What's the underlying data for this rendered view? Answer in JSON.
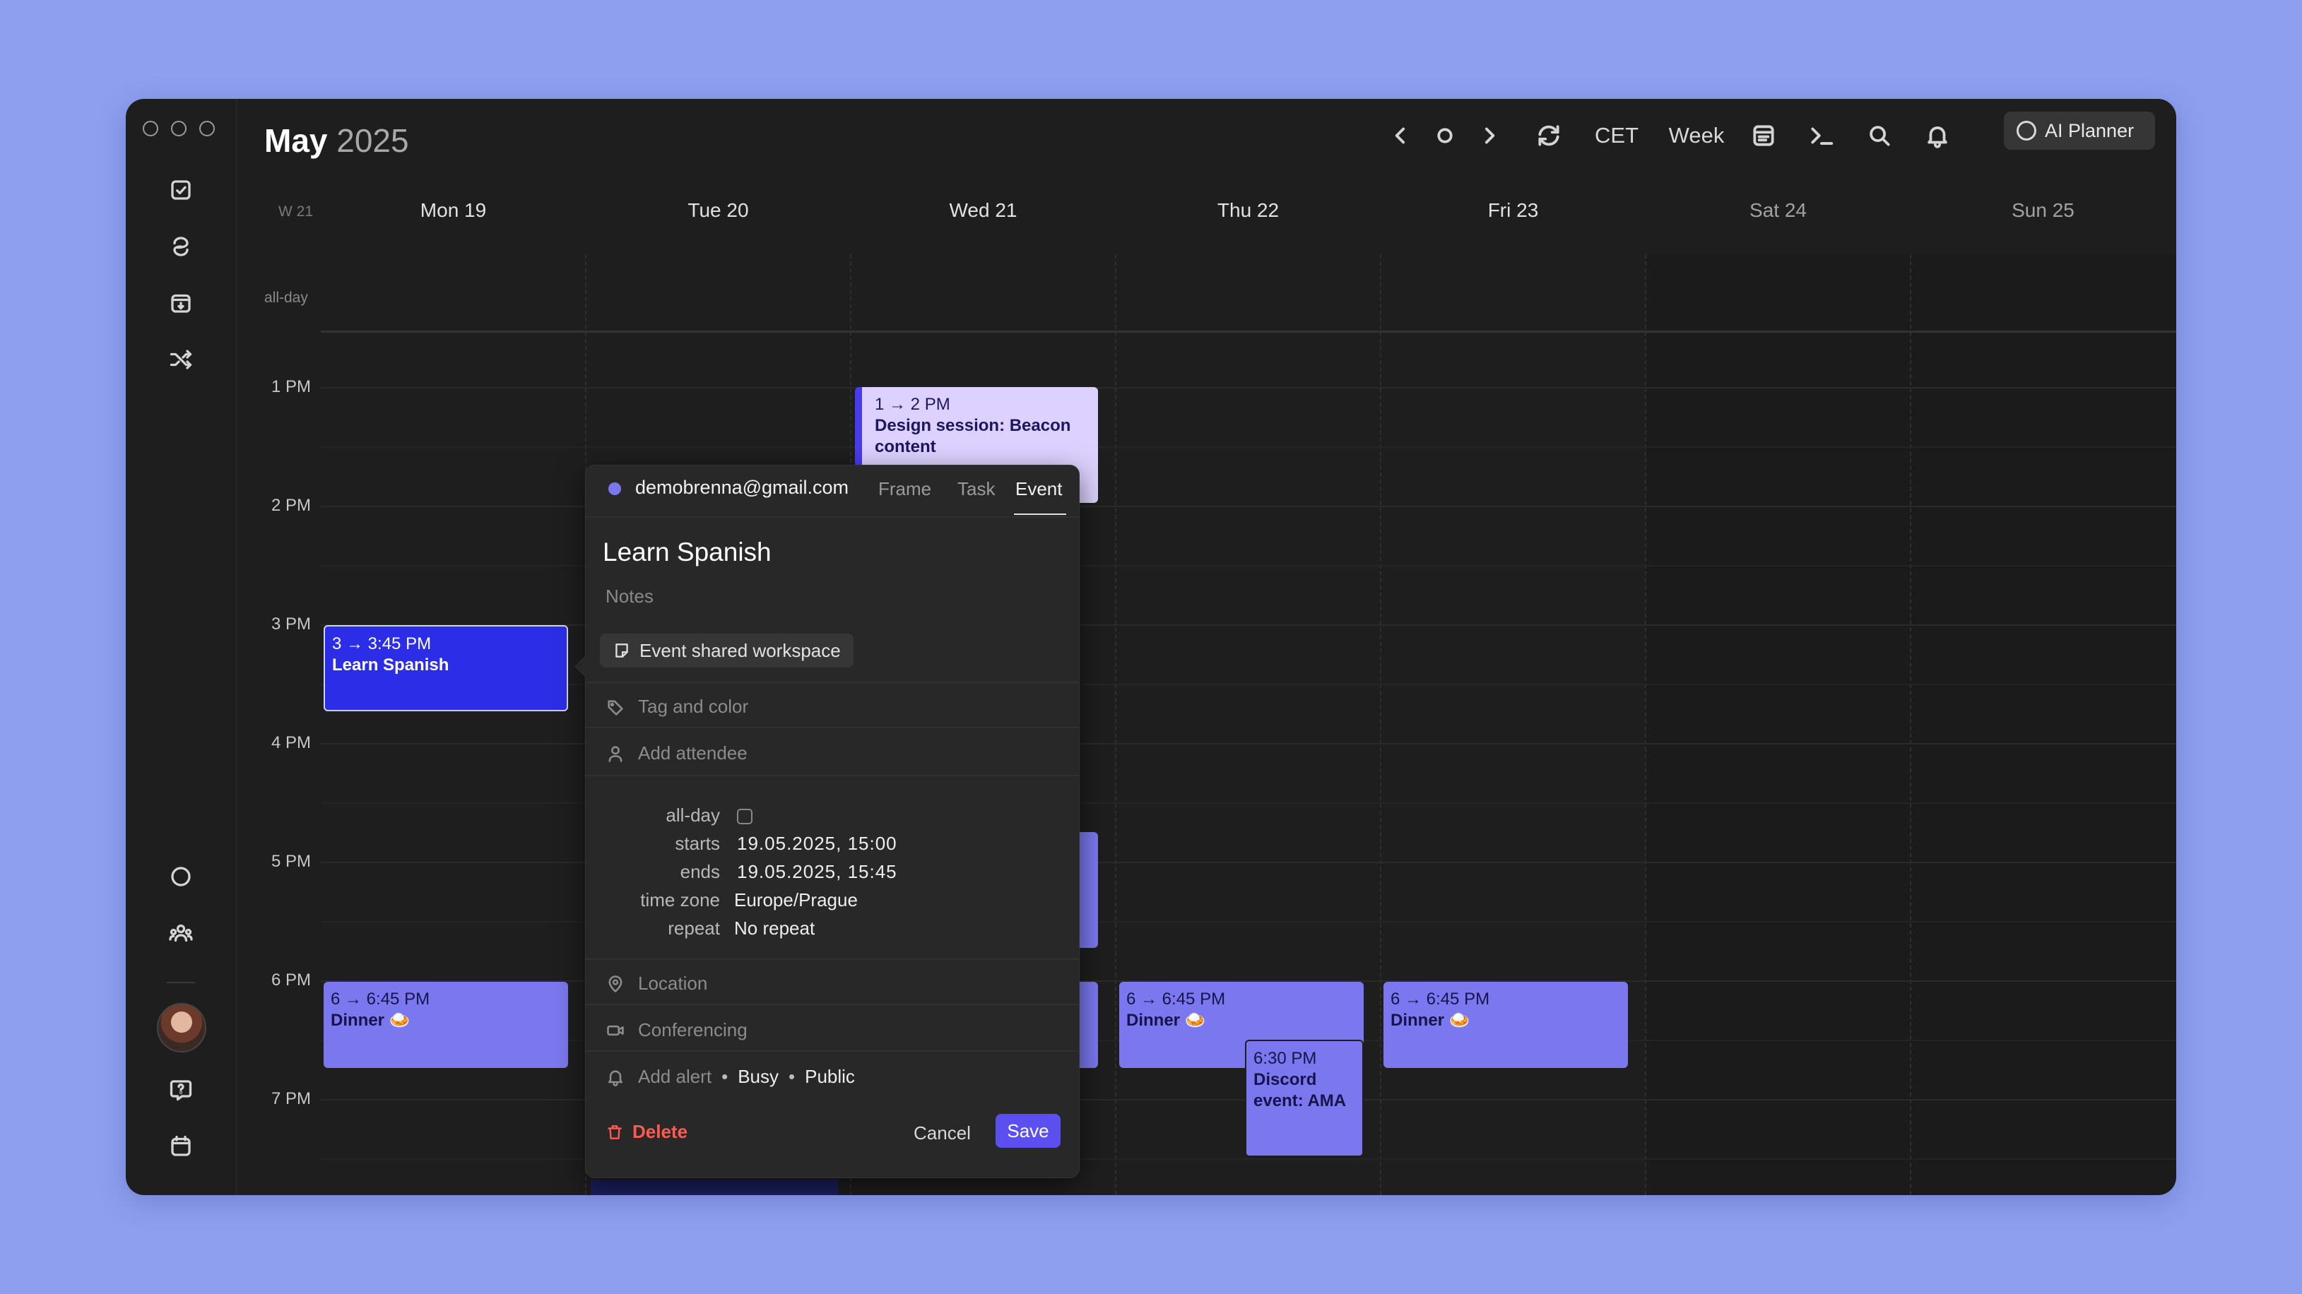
{
  "window": {
    "title_month": "May",
    "title_year": "2025"
  },
  "header": {
    "timezone": "CET",
    "view": "Week",
    "ai_planner": "AI Planner"
  },
  "calendar": {
    "week_label": "W 21",
    "all_day_label": "all-day",
    "days": [
      "Mon 19",
      "Tue 20",
      "Wed 21",
      "Thu 22",
      "Fri 23",
      "Sat 24",
      "Sun 25"
    ],
    "hours": [
      "1 PM",
      "2 PM",
      "3 PM",
      "4 PM",
      "5 PM",
      "6 PM",
      "7 PM"
    ]
  },
  "events": {
    "design": {
      "time": "1 → 2 PM",
      "name": "Design session: Beacon content"
    },
    "spanish": {
      "time": "3 → 3:45 PM",
      "name": "Learn Spanish"
    },
    "dinner_mon": {
      "time": "6 → 6:45 PM",
      "name": "Dinner 🍛"
    },
    "dinner_thu": {
      "time": "6 → 6:45 PM",
      "name": "Dinner 🍛"
    },
    "dinner_fri": {
      "time": "6 → 6:45 PM",
      "name": "Dinner 🍛"
    },
    "discord": {
      "time": "6:30 PM",
      "name": "Discord event: AMA"
    }
  },
  "popover": {
    "account": "demobrenna@gmail.com",
    "tabs": [
      "Frame",
      "Task",
      "Event"
    ],
    "active_tab": "Event",
    "event_title": "Learn Spanish",
    "notes_placeholder": "Notes",
    "workspace_chip": "Event shared workspace",
    "tag_placeholder": "Tag and color",
    "attendee_placeholder": "Add attendee",
    "fields": {
      "allday_label": "all-day",
      "starts_label": "starts",
      "starts_value": "19.05.2025, 15:00",
      "ends_label": "ends",
      "ends_value": "19.05.2025, 15:45",
      "tz_label": "time zone",
      "tz_value": "Europe/Prague",
      "repeat_label": "repeat",
      "repeat_value": "No repeat"
    },
    "location_placeholder": "Location",
    "conferencing_placeholder": "Conferencing",
    "alert_placeholder": "Add alert",
    "busy": "Busy",
    "visibility": "Public",
    "delete_label": "Delete",
    "cancel_label": "Cancel",
    "save_label": "Save"
  },
  "colors": {
    "accent": "#5b4ff0",
    "event_blue": "#2b2ee6",
    "event_purple": "#7b78ef",
    "delete_red": "#ff5a52",
    "background": "#8e9ff0"
  }
}
